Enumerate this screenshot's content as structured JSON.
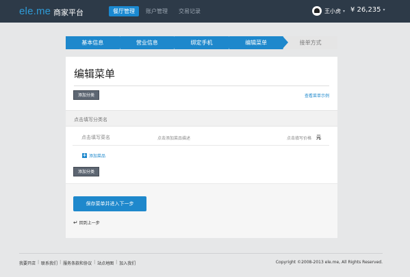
{
  "header": {
    "logo": "ele.me",
    "brand": "商家平台",
    "nav": [
      {
        "label": "餐厅管理",
        "active": true
      },
      {
        "label": "账户管理",
        "active": false
      },
      {
        "label": "交易记录",
        "active": false
      }
    ],
    "user_name": "王小虎",
    "user_caret": "▾",
    "balance": "¥ 26,235",
    "balance_caret": "▾"
  },
  "steps": [
    {
      "label": "基本信息",
      "state": "done"
    },
    {
      "label": "营业信息",
      "state": "done"
    },
    {
      "label": "绑定手机",
      "state": "done"
    },
    {
      "label": "编辑菜单",
      "state": "current"
    },
    {
      "label": "接单方式",
      "state": "todo"
    }
  ],
  "panel": {
    "title": "编辑菜单",
    "add_category_label": "添加分类",
    "example_link": "查看菜单示例",
    "category_placeholder": "点击填写分类名",
    "dish": {
      "name_placeholder": "点击填写菜名",
      "desc_placeholder": "点击添加菜品描述",
      "price_placeholder": "点击填写价格",
      "unit": "元"
    },
    "add_dish_label": "添加菜品",
    "add_category_label_2": "添加分类",
    "save_label": "保存菜单并进入下一步",
    "back_icon": "↵",
    "back_label": "回到上一步"
  },
  "footer": {
    "links": [
      "我要开店",
      "联系我们",
      "服务条款和协议",
      "站点地图",
      "加入我们"
    ],
    "separator": "|",
    "copyright": "Copyright ©2008-2013 ele.me, All Rights Reserved."
  },
  "colors": {
    "accent": "#1e88cc",
    "topbar": "#2d3a48",
    "logo": "#2f9bd7",
    "page_bg": "#e6e7e8"
  }
}
